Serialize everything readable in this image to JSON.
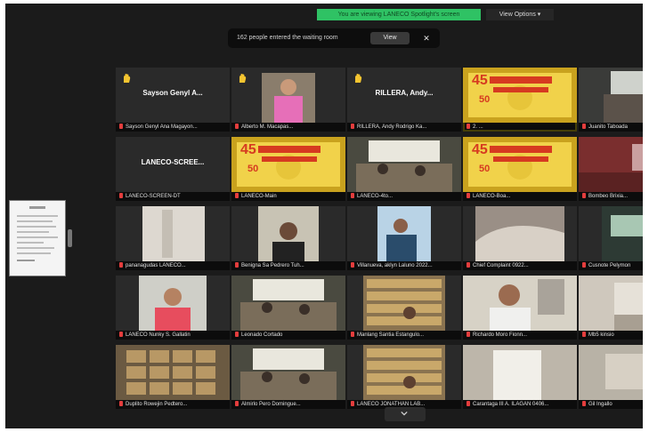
{
  "toolbar": {
    "share_banner": "You are viewing LANECO Spotlight's screen",
    "view_options": "View Options ▾"
  },
  "waiting_room": {
    "message": "162 people entered the waiting room",
    "view_label": "View",
    "close_label": "✕"
  },
  "participants": [
    {
      "id": "p1",
      "big": "Sayson Genyl A...",
      "label": "Sayson Genyl Ana Magayon...",
      "hand": true
    },
    {
      "id": "p2",
      "big": "",
      "label": "Alberto M. Macapas...",
      "hand": true
    },
    {
      "id": "p3",
      "big": "RILLERA, Andy...",
      "label": "RILLERA, Andy Rodrigo Ka...",
      "hand": true
    },
    {
      "id": "p4",
      "big": "",
      "label": "2. ...",
      "hand": false
    },
    {
      "id": "p5",
      "big": "",
      "label": "Juanito Taboada",
      "hand": false
    },
    {
      "id": "p6",
      "big": "LANECO-SCREE...",
      "label": "LANECO-SCREEN-DT",
      "hand": false
    },
    {
      "id": "p7",
      "big": "",
      "label": "LANECO-Main",
      "hand": false
    },
    {
      "id": "p8",
      "big": "",
      "label": "LANECO-4to...",
      "hand": false
    },
    {
      "id": "p9",
      "big": "",
      "label": "LANECO-Boa...",
      "hand": false
    },
    {
      "id": "p10",
      "big": "",
      "label": "Bombeo Brixia...",
      "hand": false
    },
    {
      "id": "p11",
      "big": "",
      "label": "pananagudas LANECO...",
      "hand": false
    },
    {
      "id": "p12",
      "big": "",
      "label": "Benigna Sa Pedrero Tuh...",
      "hand": false
    },
    {
      "id": "p13",
      "big": "",
      "label": "Villanueva, aklyn Laluno 2022...",
      "hand": false
    },
    {
      "id": "p14",
      "big": "",
      "label": "Chief Complaint 0922...",
      "hand": false
    },
    {
      "id": "p15",
      "big": "",
      "label": "Cusnote Pelymon",
      "hand": false
    },
    {
      "id": "p16",
      "big": "",
      "label": "LANECO Nunky S. Gallatin",
      "hand": false
    },
    {
      "id": "p17",
      "big": "",
      "label": "Leonado Cortado",
      "hand": false
    },
    {
      "id": "p18",
      "big": "",
      "label": "Manlang Santia Estangulo...",
      "hand": false
    },
    {
      "id": "p19",
      "big": "",
      "label": "Richardo Moro Fionn...",
      "hand": false
    },
    {
      "id": "p20",
      "big": "",
      "label": "Mb5 kinsio",
      "hand": false
    },
    {
      "id": "p21",
      "big": "",
      "label": "Duplito Rowejin Pedtero...",
      "hand": false
    },
    {
      "id": "p22",
      "big": "",
      "label": "Almirlo Pero Domingue...",
      "hand": false
    },
    {
      "id": "p23",
      "big": "",
      "label": "LANECO JONATHAN LAB...",
      "hand": false
    },
    {
      "id": "p24",
      "big": "",
      "label": "Carantaga III A. ILAGAN 0406...",
      "hand": false
    },
    {
      "id": "p25",
      "big": "",
      "label": "Gil Ingallo",
      "hand": false
    }
  ],
  "banner_text": {
    "year": "45",
    "sub": "50"
  },
  "colors": {
    "active_border": "#e8d21b",
    "share_green": "#2fc264",
    "mic_red": "#e43d3d",
    "hand_yellow": "#f4c430"
  },
  "icons": {
    "hand": "raised-hand-icon",
    "mic": "muted-mic-icon",
    "chevron": "chevron-down-icon"
  }
}
